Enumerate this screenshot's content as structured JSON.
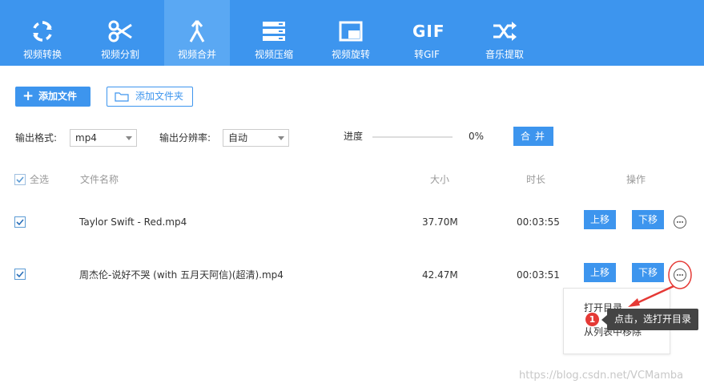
{
  "toolbar": {
    "tabs": [
      {
        "label": "视频转换",
        "icon": "sync-icon"
      },
      {
        "label": "视频分割",
        "icon": "scissors-icon"
      },
      {
        "label": "视频合并",
        "icon": "merge-icon",
        "active": true
      },
      {
        "label": "视频压缩",
        "icon": "compress-icon"
      },
      {
        "label": "视频旋转",
        "icon": "rotate-icon"
      },
      {
        "label": "转GIF",
        "icon": "gif-icon",
        "icon_text": "GIF"
      },
      {
        "label": "音乐提取",
        "icon": "shuffle-icon"
      }
    ]
  },
  "actions": {
    "add_file_label": "添加文件",
    "add_folder_label": "添加文件夹"
  },
  "options": {
    "format_label": "输出格式:",
    "format_value": "mp4",
    "resolution_label": "输出分辨率:",
    "resolution_value": "自动",
    "progress_label": "进度",
    "progress_value": "0%",
    "progress_fraction": 0,
    "merge_label": "合并"
  },
  "table": {
    "select_all_label": "全选",
    "columns": {
      "name": "文件名称",
      "size": "大小",
      "duration": "时长",
      "actions": "操作"
    },
    "rows": [
      {
        "checked": true,
        "name": "Taylor Swift - Red.mp4",
        "size": "37.70M",
        "duration": "00:03:55",
        "up_label": "上移",
        "down_label": "下移"
      },
      {
        "checked": true,
        "name": "周杰伦-说好不哭 (with 五月天阿信)(超清).mp4",
        "size": "42.47M",
        "duration": "00:03:51",
        "up_label": "上移",
        "down_label": "下移"
      }
    ]
  },
  "menu": {
    "items": [
      "打开目录",
      "从列表中移除"
    ]
  },
  "annotation": {
    "badge": "1",
    "callout": "点击，选打开目录",
    "color": "#e53935"
  },
  "watermark": "https://blog.csdn.net/VCMamba",
  "colors": {
    "toolbar_bg": "#3d95ee",
    "active_tab_bg": "#5aa8f3",
    "button_bg": "#3d95ee"
  }
}
